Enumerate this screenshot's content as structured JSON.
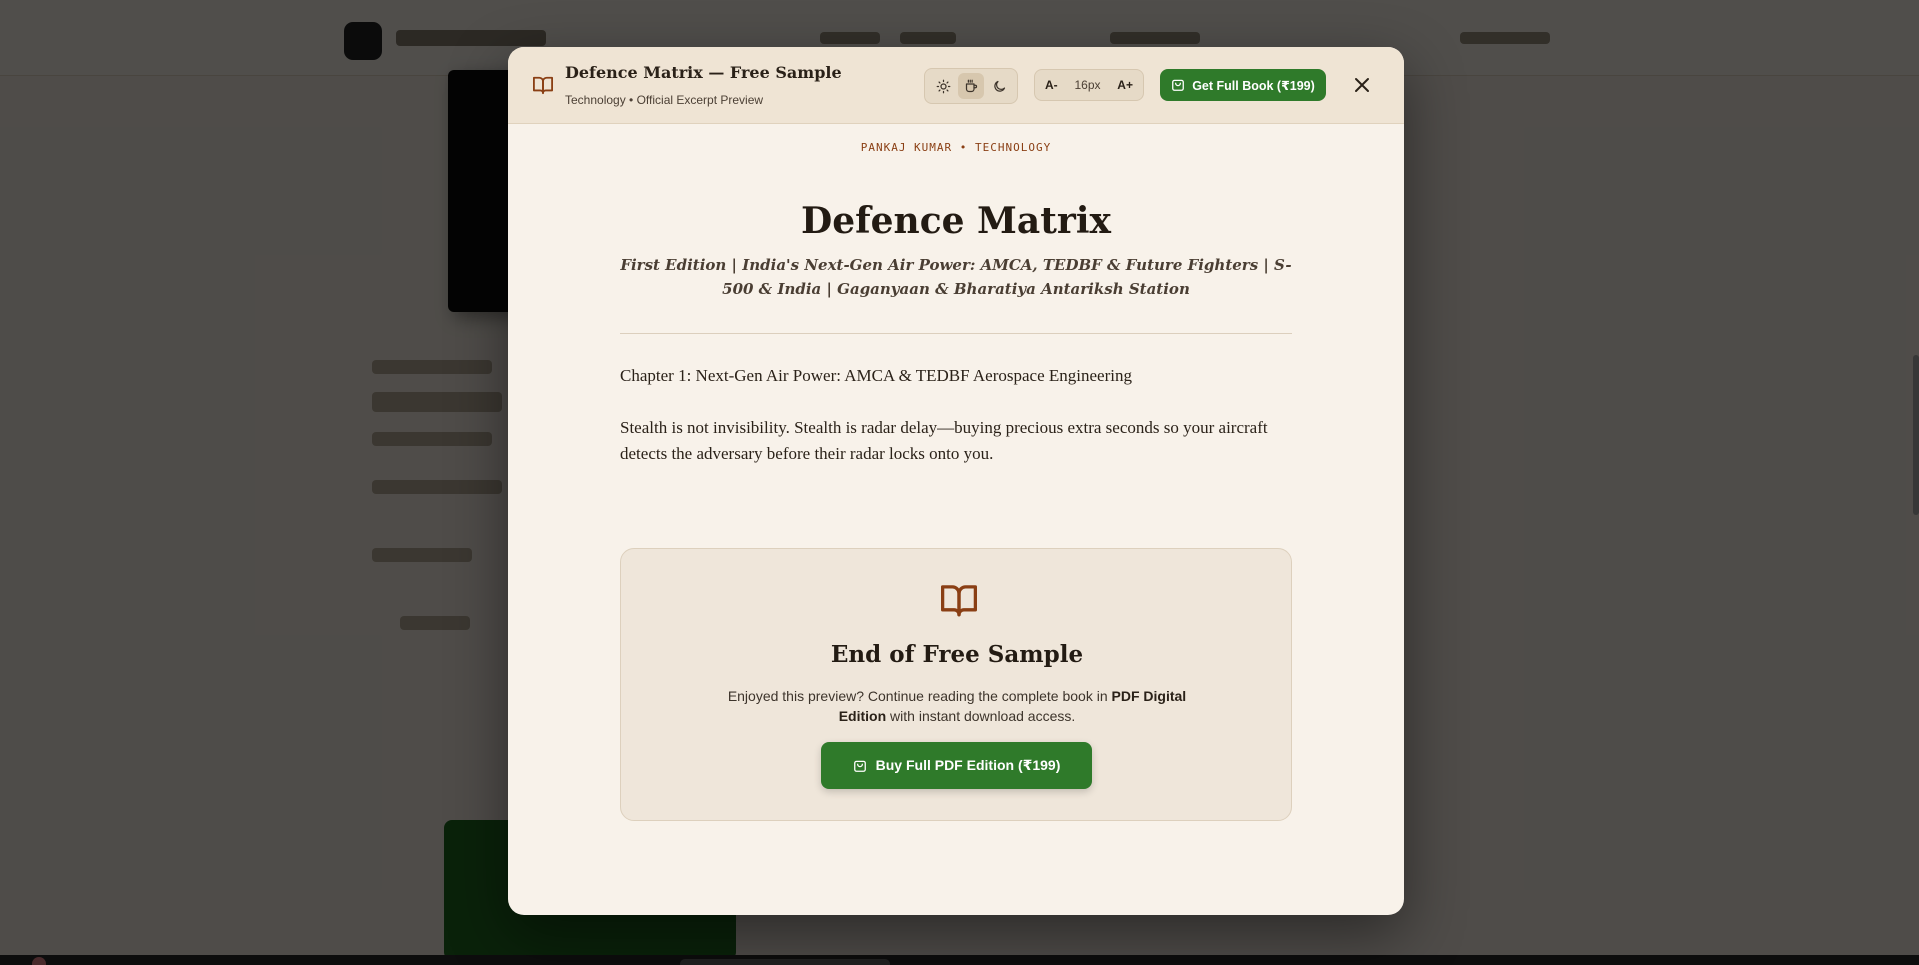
{
  "header": {
    "title": "Defence Matrix — Free Sample",
    "subtitle": "Technology • Official Excerpt Preview",
    "font_decrease": "A-",
    "font_size": "16px",
    "font_increase": "A+",
    "get_full_book": "Get Full Book (₹199)"
  },
  "book": {
    "byline": "PANKAJ KUMAR • TECHNOLOGY",
    "title": "Defence Matrix",
    "subtitle": "First Edition | India's Next-Gen Air Power: AMCA, TEDBF & Future Fighters | S-500 & India | Gaganyaan & Bharatiya Antariksh Station",
    "chapter": "Chapter 1: Next-Gen Air Power: AMCA & TEDBF Aerospace Engineering",
    "excerpt": "Stealth is not invisibility. Stealth is radar delay—buying precious extra seconds so your aircraft detects the adversary before their radar locks onto you."
  },
  "end_sample": {
    "title": "End of Free Sample",
    "text_before": "Enjoyed this preview? Continue reading the complete book in ",
    "text_bold": "PDF Digital Edition",
    "text_after": " with instant download access.",
    "buy_button": "Buy Full PDF Edition (₹199)"
  },
  "theme": {
    "options": [
      "light-theme",
      "sepia-theme",
      "dark-theme"
    ],
    "active": "sepia-theme"
  },
  "colors": {
    "accent_brown": "#8a3f14",
    "button_green": "#2f7a2a",
    "modal_bg": "#f8f2ea",
    "header_bg": "#efe4d4"
  }
}
